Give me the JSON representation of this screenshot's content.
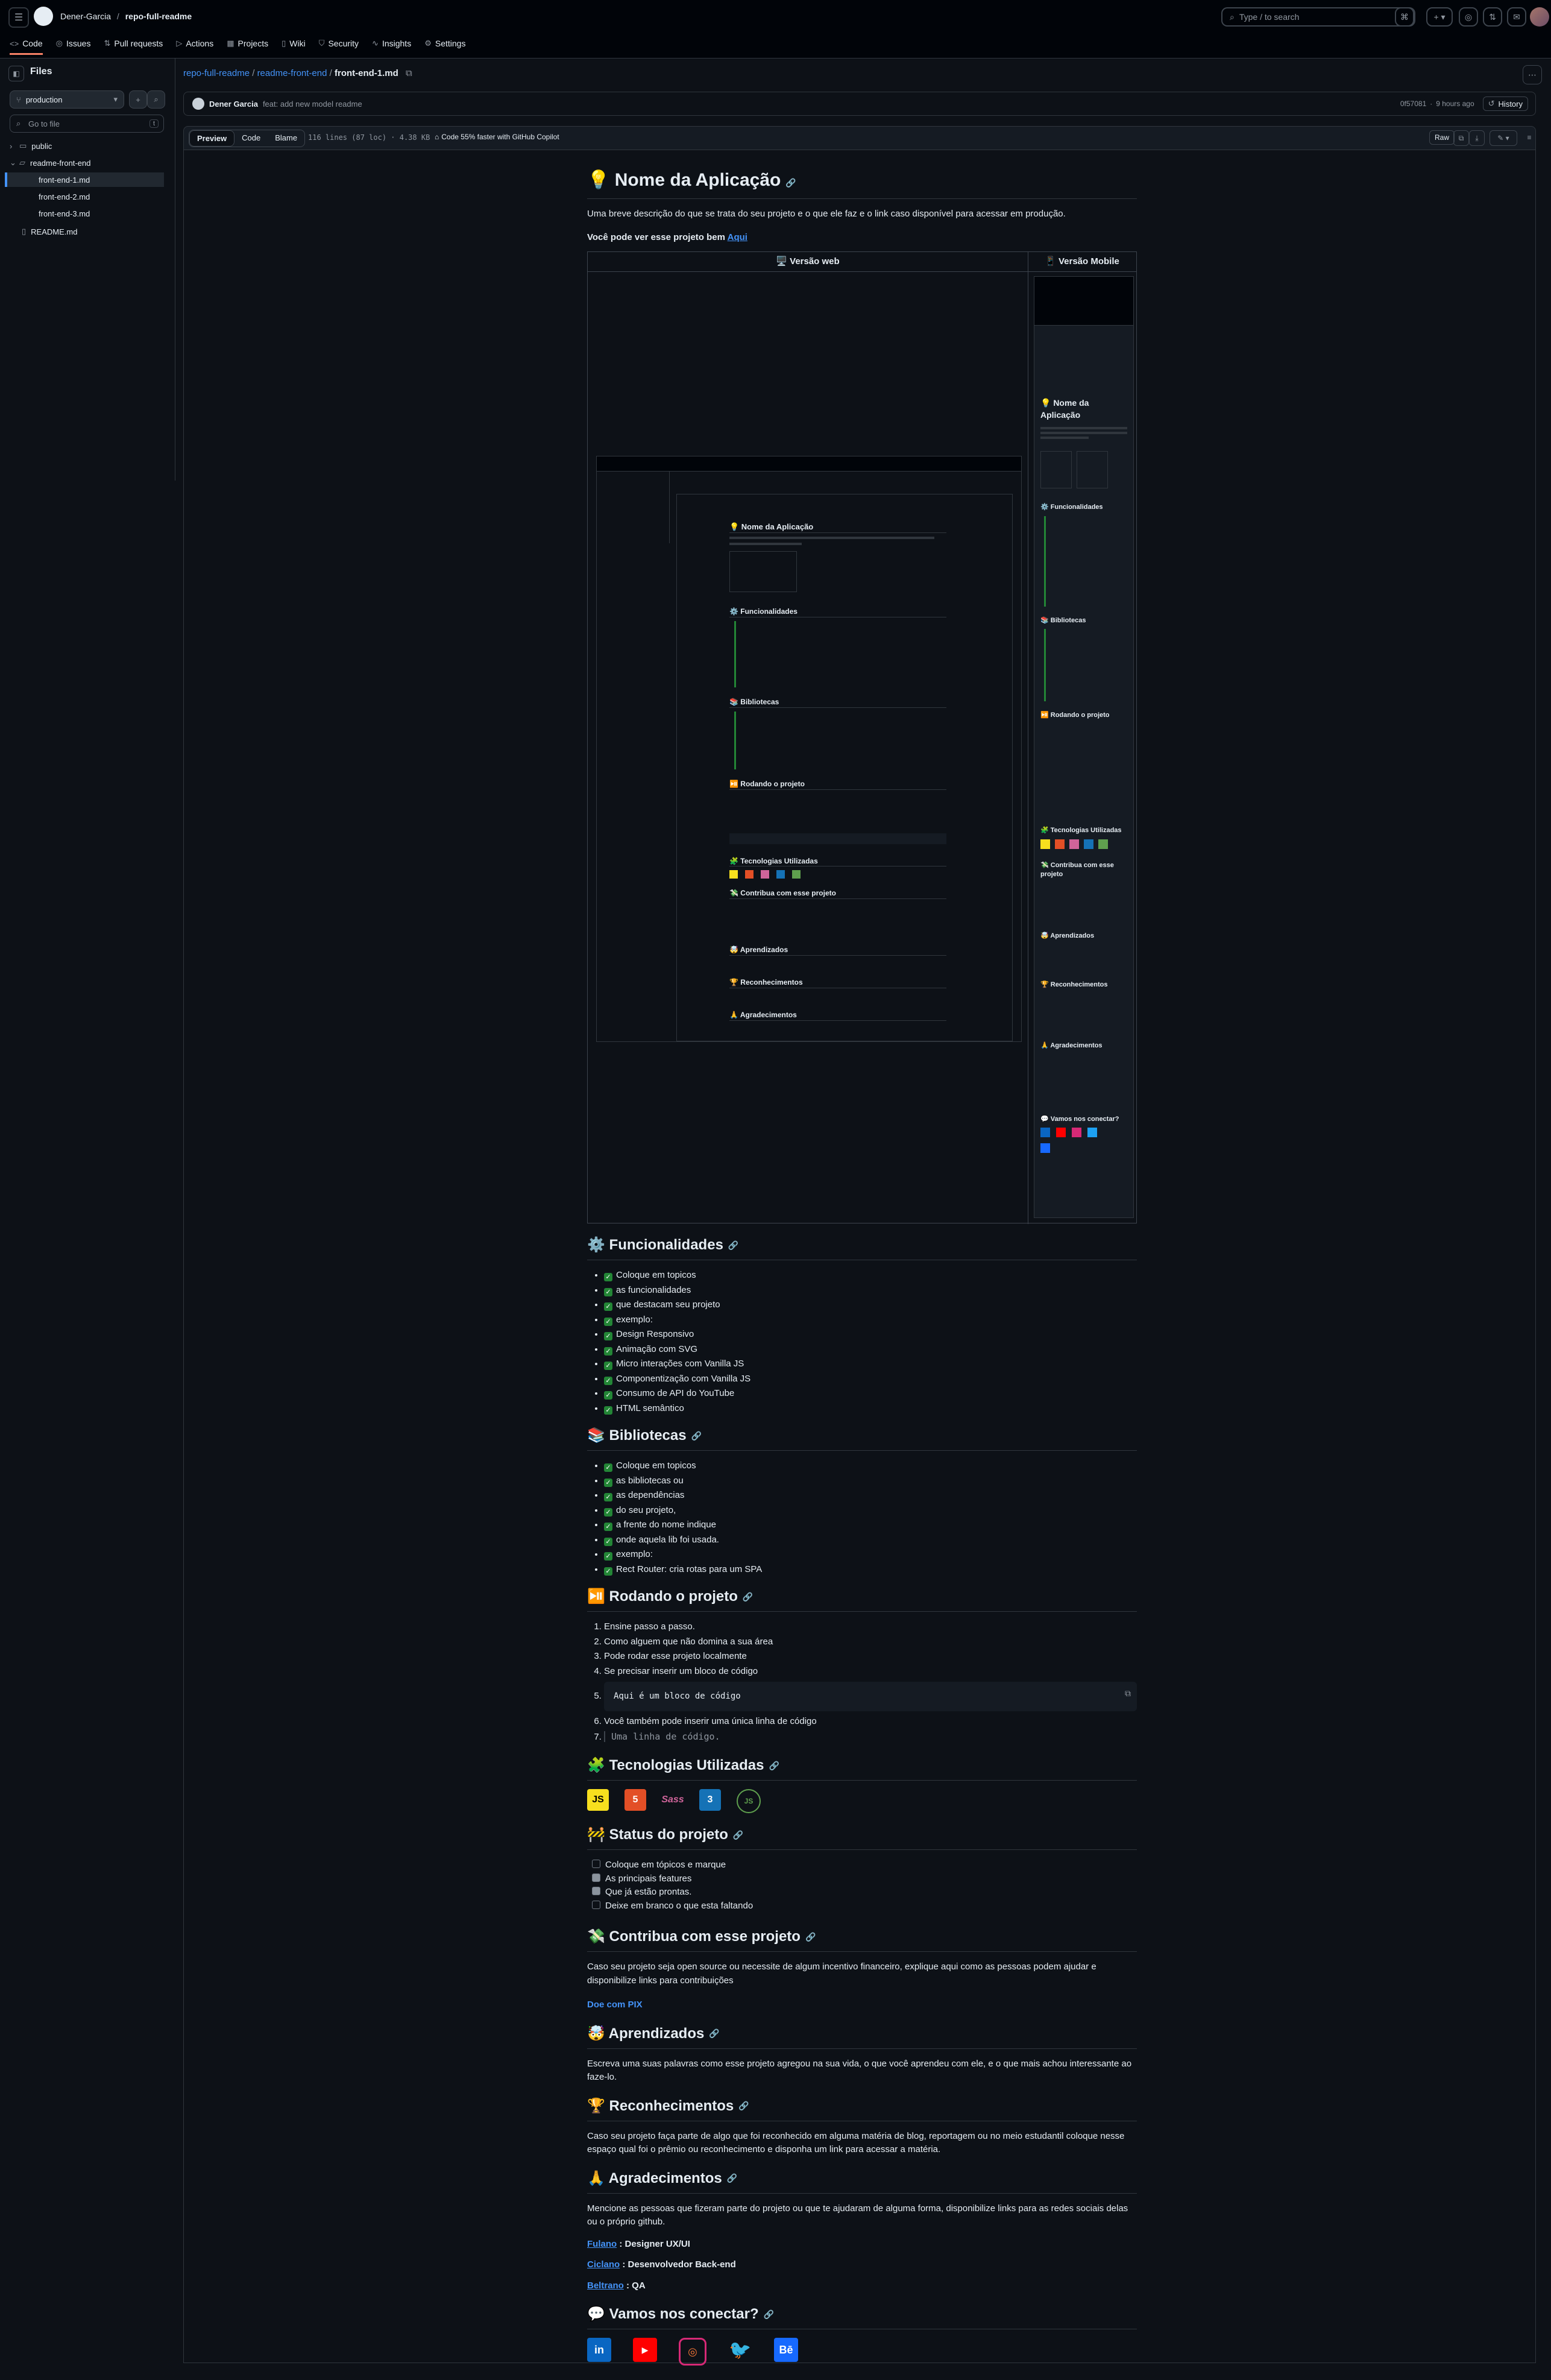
{
  "header": {
    "owner": "Dener-Garcia",
    "repo": "repo-full-readme",
    "search_placeholder": "Type / to search",
    "tabs": [
      {
        "label": "Code",
        "icon": "code-icon"
      },
      {
        "label": "Issues",
        "icon": "issue-icon"
      },
      {
        "label": "Pull requests",
        "icon": "pull-request-icon"
      },
      {
        "label": "Actions",
        "icon": "play-icon"
      },
      {
        "label": "Projects",
        "icon": "table-icon"
      },
      {
        "label": "Wiki",
        "icon": "book-icon"
      },
      {
        "label": "Security",
        "icon": "shield-icon"
      },
      {
        "label": "Insights",
        "icon": "graph-icon"
      },
      {
        "label": "Settings",
        "icon": "gear-icon"
      }
    ]
  },
  "sidebar": {
    "title": "Files",
    "branch": "production",
    "go_to_file_placeholder": "Go to file",
    "shortcut": "t",
    "tree": [
      {
        "label": "public",
        "type": "folder"
      },
      {
        "label": "readme-front-end",
        "type": "folder-open"
      },
      {
        "label": "front-end-1.md",
        "type": "file"
      },
      {
        "label": "front-end-2.md",
        "type": "file"
      },
      {
        "label": "front-end-3.md",
        "type": "file"
      },
      {
        "label": "README.md",
        "type": "file"
      }
    ]
  },
  "file": {
    "path_repo": "repo-full-readme",
    "path_dir": "readme-front-end",
    "path_file": "front-end-1.md",
    "author": "Dener Garcia",
    "commit_message": "feat: add new model readme",
    "commit_sha": "0f57081",
    "commit_time": "9 hours ago",
    "history_label": "History",
    "view_tabs": [
      "Preview",
      "Code",
      "Blame"
    ],
    "lines_info": "116 lines (87 loc) · 4.38 KB",
    "copilot_label": "Code 55% faster with GitHub Copilot",
    "raw_label": "Raw"
  },
  "readme": {
    "title": "💡 Nome da Aplicação",
    "intro": "Uma breve descrição do que se trata do seu projeto e o que ele faz e o link caso disponível para acessar em produção.",
    "see_here_prefix": "Você pode ver esse projeto bem",
    "see_here_link": "Aqui",
    "table_headers": [
      "🖥️ Versão web",
      "📱 Versão Mobile"
    ],
    "features_title": "⚙️ Funcionalidades",
    "features": [
      "Coloque em topicos",
      "as funcionalidades",
      "que destacam seu projeto",
      "exemplo:",
      "Design Responsivo",
      "Animação com SVG",
      "Micro interações com Vanilla JS",
      "Componentização com Vanilla JS",
      "Consumo de API do YouTube",
      "HTML semântico"
    ],
    "libs_title": "📚 Bibliotecas",
    "libs": [
      "Coloque em topicos",
      "as bibliotecas ou",
      "as dependências",
      "do seu projeto,",
      "a frente do nome indique",
      "onde aquela lib foi usada.",
      "exemplo:",
      "Rect Router: cria rotas para um SPA"
    ],
    "run_title": "⏯️ Rodando o projeto",
    "run_steps": [
      "Ensine passo a passo.",
      "Como alguem que não domina a sua área",
      "Pode rodar esse projeto localmente",
      "Se precisar inserir um bloco de código"
    ],
    "code_block": "Aqui é um bloco de código",
    "run_step_6": "Você também pode inserir uma única linha de código",
    "inline_code": "Uma linha de código.",
    "tech_title": "🧩 Tecnologias Utilizadas",
    "techs": [
      {
        "name": "JavaScript",
        "glyph": "JS",
        "color": "#f7df1e",
        "fg": "#000000"
      },
      {
        "name": "HTML5",
        "glyph": "5",
        "color": "#e34f26",
        "fg": "#ffffff"
      },
      {
        "name": "Sass",
        "glyph": "Sass",
        "color": "#0d1117",
        "fg": "#cf649a"
      },
      {
        "name": "CSS3",
        "glyph": "3",
        "color": "#1572b6",
        "fg": "#ffffff"
      },
      {
        "name": "Node.js",
        "glyph": "JS",
        "color": "#0d1117",
        "fg": "#5fa04e"
      }
    ],
    "status_title": "🚧 Status do projeto",
    "status": [
      {
        "label": "Coloque em tópicos e marque",
        "checked": false
      },
      {
        "label": "As principais features",
        "checked": true
      },
      {
        "label": "Que já estão prontas.",
        "checked": true
      },
      {
        "label": "Deixe em branco o que esta faltando",
        "checked": false
      }
    ],
    "contrib_title": "💸 Contribua com esse projeto",
    "contrib_text": "Caso seu projeto seja open source ou necessite de algum incentivo financeiro, explique aqui como as pessoas podem ajudar e disponibilize links para contribuições",
    "contrib_link": "Doe com PIX",
    "learn_title": "🤯 Aprendizados",
    "learn_text": "Escreva uma suas palavras como esse projeto agregou na sua vida, o que você aprendeu com ele, e o que mais achou interessante ao faze-lo.",
    "recog_title": "🏆 Reconhecimentos",
    "recog_text": "Caso seu projeto faça parte de algo que foi reconhecido em alguma matéria de blog, reportagem ou no meio estudantil coloque nesse espaço qual foi o prêmio ou reconhecimento e disponha um link para acessar a matéria.",
    "thanks_title": "🙏 Agradecimentos",
    "thanks_text": "Mencione as pessoas que fizeram parte do projeto ou que te ajudaram de alguma forma, disponibilize links para as redes sociais delas ou o próprio github.",
    "people": [
      {
        "name": "Fulano",
        "role": ": Designer UX/UI"
      },
      {
        "name": "Ciclano",
        "role": ": Desenvolvedor Back-end"
      },
      {
        "name": "Beltrano",
        "role": ": QA"
      }
    ],
    "connect_title": "💬 Vamos nos conectar?",
    "socials": [
      {
        "name": "LinkedIn",
        "glyph": "in",
        "color": "#0a66c2"
      },
      {
        "name": "YouTube",
        "glyph": "▶",
        "color": "#ff0000"
      },
      {
        "name": "Instagram",
        "glyph": "◎",
        "color": "#d62976"
      },
      {
        "name": "Twitter",
        "glyph": "🐦",
        "color": "#1da1f2"
      },
      {
        "name": "Behance",
        "glyph": "Bē",
        "color": "#1769ff"
      }
    ]
  }
}
